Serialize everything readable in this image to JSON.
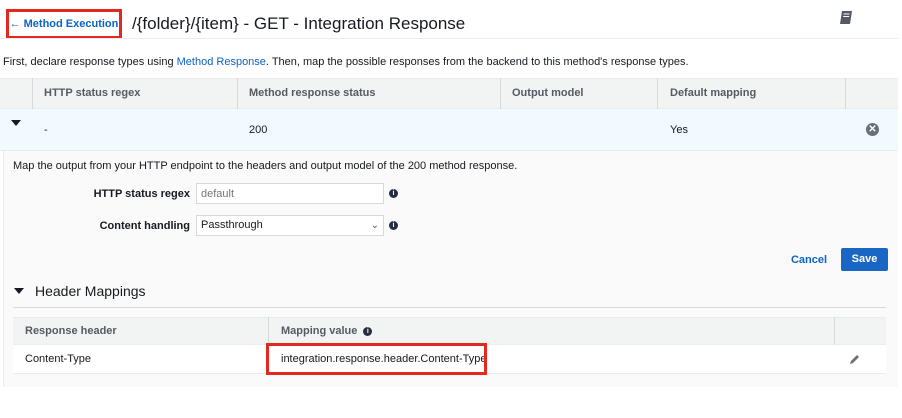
{
  "header": {
    "back_label": "Method Execution",
    "back_arrow": "←",
    "title": "/{folder}/{item} - GET - Integration Response",
    "book_icon": "book-icon"
  },
  "intro": {
    "prefix": "First, declare response types using ",
    "link": "Method Response",
    "suffix": ". Then, map the possible responses from the backend to this method's response types."
  },
  "responses_table": {
    "columns": [
      "HTTP status regex",
      "Method response status",
      "Output model",
      "Default mapping"
    ],
    "rows": [
      {
        "status_regex": "-",
        "method_status": "200",
        "output_model": "",
        "default_mapping": "Yes"
      }
    ]
  },
  "detail": {
    "description": "Map the output from your HTTP endpoint to the headers and output model of the 200 method response.",
    "status_regex_label": "HTTP status regex",
    "status_regex_placeholder": "default",
    "content_handling_label": "Content handling",
    "content_handling_value": "Passthrough",
    "cancel_label": "Cancel",
    "save_label": "Save"
  },
  "header_mappings": {
    "title": "Header Mappings",
    "columns": [
      "Response header",
      "Mapping value"
    ],
    "rows": [
      {
        "response_header": "Content-Type",
        "mapping_value": "integration.response.header.Content-Type"
      }
    ]
  },
  "colors": {
    "accent": "#1a66c4",
    "link": "#0b63c7",
    "highlight": "#e3291f"
  }
}
